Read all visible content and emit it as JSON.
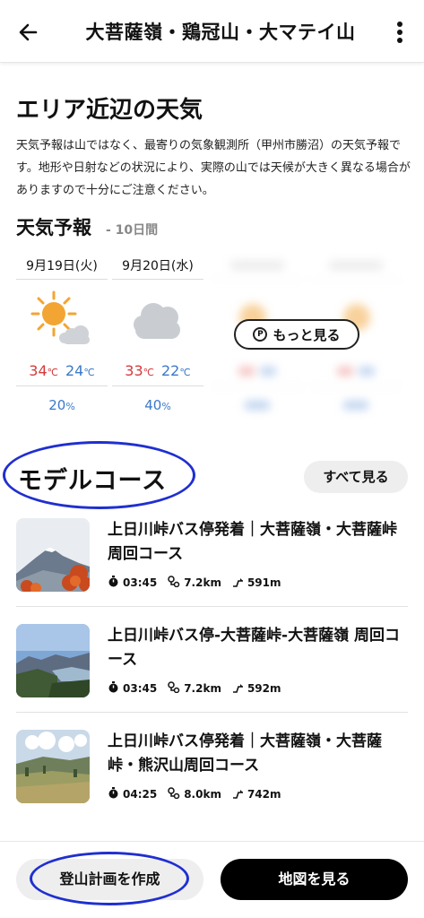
{
  "header": {
    "title": "大菩薩嶺・鶏冠山・大マテイ山",
    "back_icon": "back-arrow-icon",
    "more_icon": "vertical-dots-icon"
  },
  "weather": {
    "title": "エリア近辺の天気",
    "description": "天気予報は山ではなく、最寄りの気象観測所（甲州市勝沼）の天気予報です。地形や日射などの状況により、実際の山では天候が大きく異なる場合がありますので十分にご注意ください。",
    "forecast_title": "天気予報",
    "forecast_subtitle": "- 10日間",
    "temp_unit": "℃",
    "rain_unit": "%",
    "days": [
      {
        "date": "9月19日(火)",
        "icon": "sun-cloud-icon",
        "high": "34",
        "low": "24",
        "rain": "20"
      },
      {
        "date": "9月20日(水)",
        "icon": "cloud-icon",
        "high": "33",
        "low": "22",
        "rain": "40"
      }
    ],
    "more_button": "もっと見る"
  },
  "model_course": {
    "title": "モデルコース",
    "see_all": "すべて見る",
    "courses": [
      {
        "name": "上日川峠バス停発着｜大菩薩嶺・大菩薩峠周回コース",
        "time": "03:45",
        "distance": "7.2km",
        "ascent": "591m"
      },
      {
        "name": "上日川峠バス停-大菩薩峠-大菩薩嶺 周回コース",
        "time": "03:45",
        "distance": "7.2km",
        "ascent": "592m"
      },
      {
        "name": "上日川峠バス停発着｜大菩薩嶺・大菩薩峠・熊沢山周回コース",
        "time": "04:25",
        "distance": "8.0km",
        "ascent": "742m"
      }
    ]
  },
  "bottom": {
    "plan_button": "登山計画を作成",
    "map_button": "地図を見る"
  },
  "colors": {
    "temp_high": "#d33a3a",
    "temp_low": "#3a79c8",
    "annotation_circle": "#1f2fd0"
  }
}
